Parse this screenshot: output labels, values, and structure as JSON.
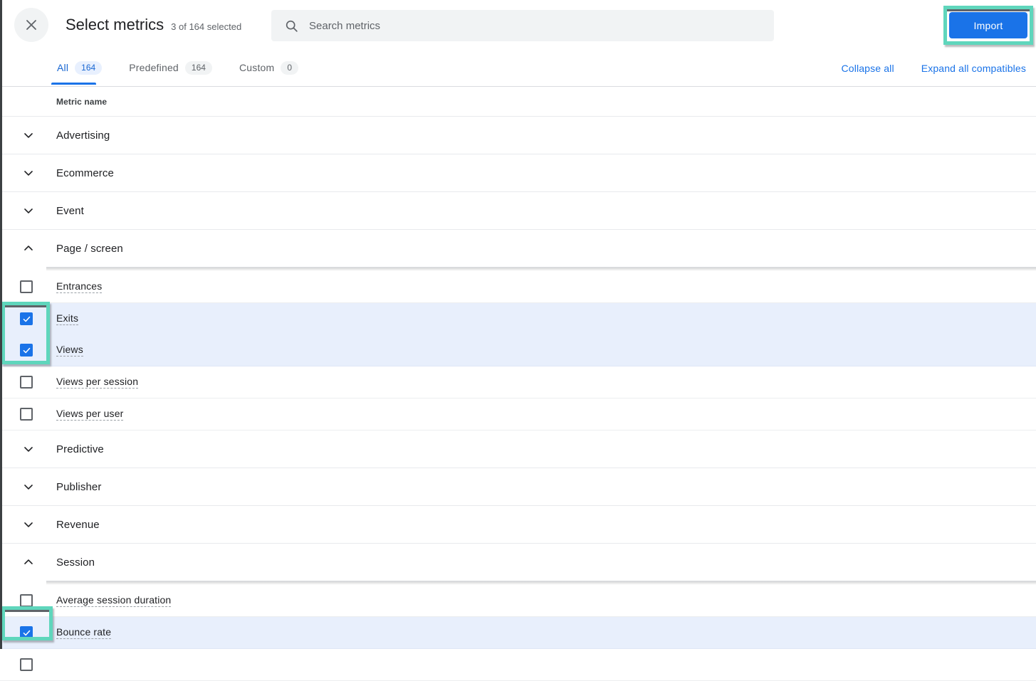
{
  "window": {
    "edge_color": "#3c4043"
  },
  "header": {
    "close_icon": "close-icon",
    "title": "Select metrics",
    "subtitle": "3 of 164 selected",
    "search": {
      "icon": "search-icon",
      "placeholder": "Search metrics",
      "value": ""
    },
    "import_label": "Import",
    "import_color": "#1a73e8",
    "highlight_color": "#5fd6bc"
  },
  "tabs": [
    {
      "label": "All",
      "count": "164",
      "active": true
    },
    {
      "label": "Predefined",
      "count": "164",
      "active": false
    },
    {
      "label": "Custom",
      "count": "0",
      "active": false
    }
  ],
  "header_actions": [
    {
      "label": "Collapse all"
    },
    {
      "label": "Expand all compatibles"
    }
  ],
  "table": {
    "column_header": "Metric name",
    "rows": [
      {
        "kind": "group",
        "label": "Advertising",
        "expanded": false,
        "icon": "chevron-down-icon"
      },
      {
        "kind": "group",
        "label": "Ecommerce",
        "expanded": false,
        "icon": "chevron-down-icon"
      },
      {
        "kind": "group",
        "label": "Event",
        "expanded": false,
        "icon": "chevron-down-icon"
      },
      {
        "kind": "group",
        "label": "Page / screen",
        "expanded": true,
        "icon": "chevron-up-icon"
      },
      {
        "kind": "metric",
        "label": "Entrances",
        "checked": false
      },
      {
        "kind": "metric",
        "label": "Exits",
        "checked": true
      },
      {
        "kind": "metric",
        "label": "Views",
        "checked": true
      },
      {
        "kind": "metric",
        "label": "Views per session",
        "checked": false
      },
      {
        "kind": "metric",
        "label": "Views per user",
        "checked": false
      },
      {
        "kind": "group",
        "label": "Predictive",
        "expanded": false,
        "icon": "chevron-down-icon"
      },
      {
        "kind": "group",
        "label": "Publisher",
        "expanded": false,
        "icon": "chevron-down-icon"
      },
      {
        "kind": "group",
        "label": "Revenue",
        "expanded": false,
        "icon": "chevron-down-icon"
      },
      {
        "kind": "group",
        "label": "Session",
        "expanded": true,
        "icon": "chevron-up-icon"
      },
      {
        "kind": "metric",
        "label": "Average session duration",
        "checked": false
      },
      {
        "kind": "metric",
        "label": "Bounce rate",
        "checked": true
      },
      {
        "kind": "metric",
        "label": "",
        "checked": false,
        "partial": true
      }
    ]
  }
}
